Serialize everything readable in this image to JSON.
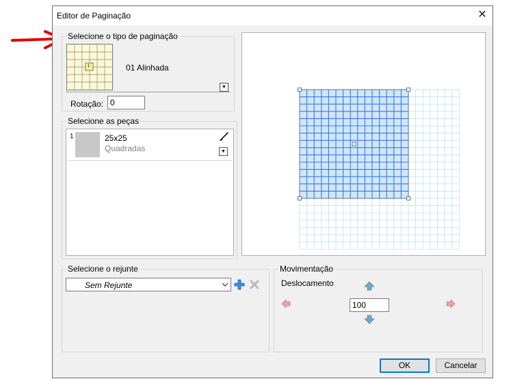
{
  "dialog": {
    "title": "Editor de Paginação",
    "close_glyph": "✕"
  },
  "pagination_type": {
    "legend": "Selecione o tipo de paginação",
    "selected_label": "01 Alinhada",
    "thumb_number": "1",
    "rotation_label": "Rotação:",
    "rotation_value": "0"
  },
  "pieces": {
    "legend": "Selecione as peças",
    "items": [
      {
        "index": "1",
        "name": "25x25",
        "subtitle": "Quadradas"
      }
    ]
  },
  "grout": {
    "legend": "Selecione o rejunte",
    "selected": "Sem Rejunte"
  },
  "movement": {
    "legend": "Movimentação",
    "offset_label": "Deslocamento",
    "offset_value": "100"
  },
  "buttons": {
    "ok": "OK",
    "cancel": "Cancelar"
  },
  "colors": {
    "annotation_arrow": "#e00000",
    "tile_blue": "#2f7de1",
    "grid_light": "#a9d6f0",
    "thumb_bg": "#fbf8d8"
  },
  "icons": {
    "paint": "paintbrush-icon",
    "add": "plus-icon",
    "delete": "x-icon",
    "up": "arrow-up-icon",
    "down": "arrow-down-icon",
    "left": "arrow-left-icon",
    "right": "arrow-right-icon"
  }
}
